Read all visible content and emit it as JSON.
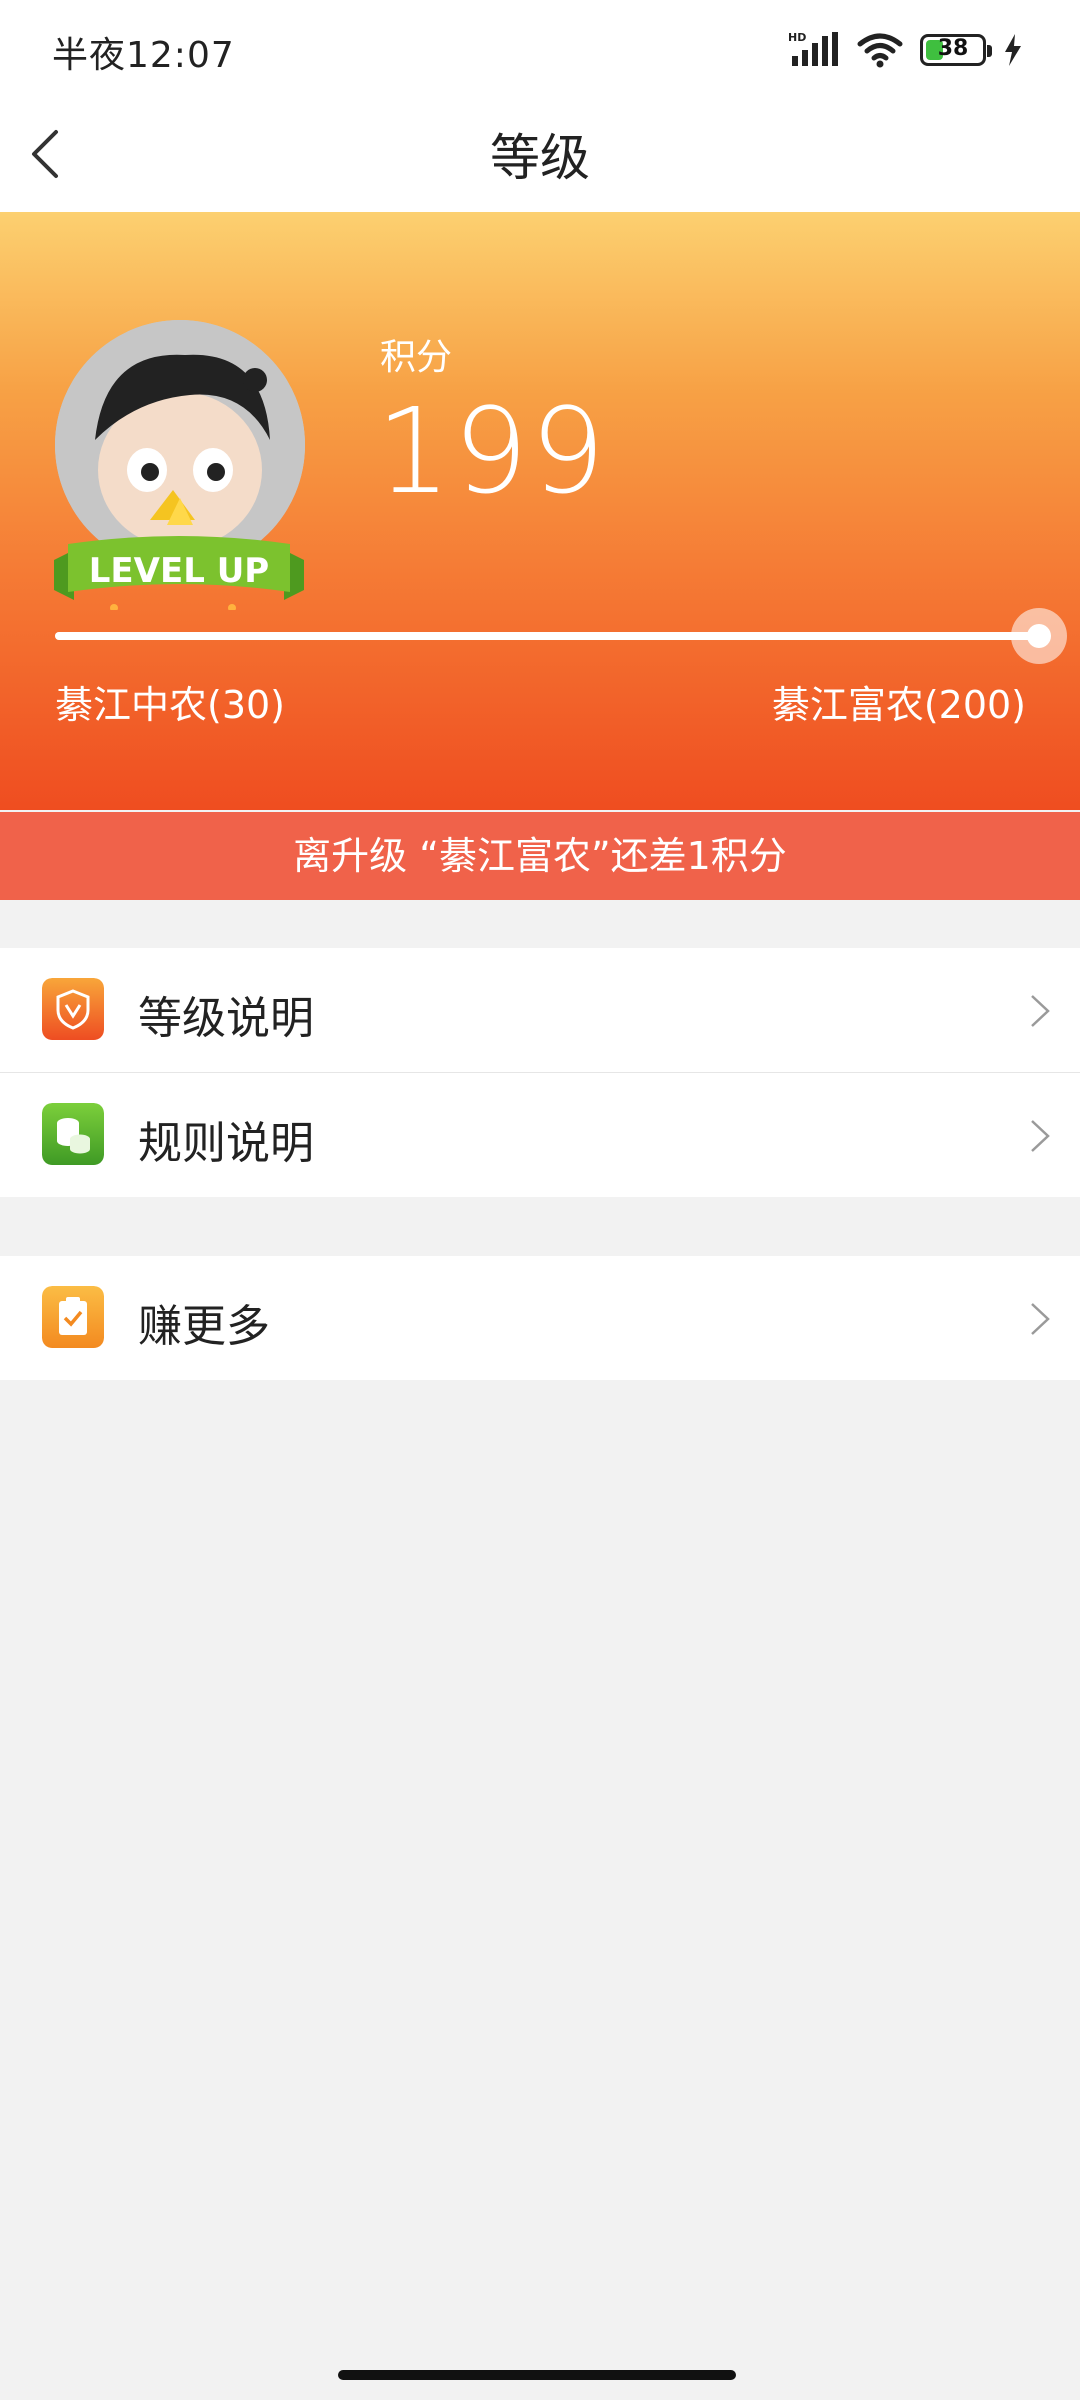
{
  "status_bar": {
    "time": "半夜12:07",
    "battery_level": "38",
    "battery_fraction": 0.38,
    "network_badge": "HD",
    "icons": [
      "signal-icon",
      "wifi-icon",
      "battery-icon",
      "charging-icon"
    ]
  },
  "nav": {
    "title": "等级",
    "back_icon": "chevron-left-icon"
  },
  "hero": {
    "points_label": "积分",
    "points_value": "199",
    "avatar_badge": "LEVEL UP",
    "current_level": "綦江中农(30)",
    "next_level": "綦江富农(200)",
    "progress_fraction": 0.994,
    "upgrade_hint": "离升级 “綦江富农”还差1积分"
  },
  "menu": {
    "group1": [
      {
        "label": "等级说明",
        "icon": "shield-v-icon",
        "color": "#f2672e"
      },
      {
        "label": "规则说明",
        "icon": "coins-icon",
        "color": "#59b030"
      }
    ],
    "group2": [
      {
        "label": "赚更多",
        "icon": "clipboard-check-icon",
        "color": "#f6a02c"
      }
    ]
  },
  "colors": {
    "hero_top": "#fcd070",
    "hero_bottom": "#ef4d20",
    "upgrade_bar": "#f0624a",
    "background": "#f2f2f2"
  }
}
